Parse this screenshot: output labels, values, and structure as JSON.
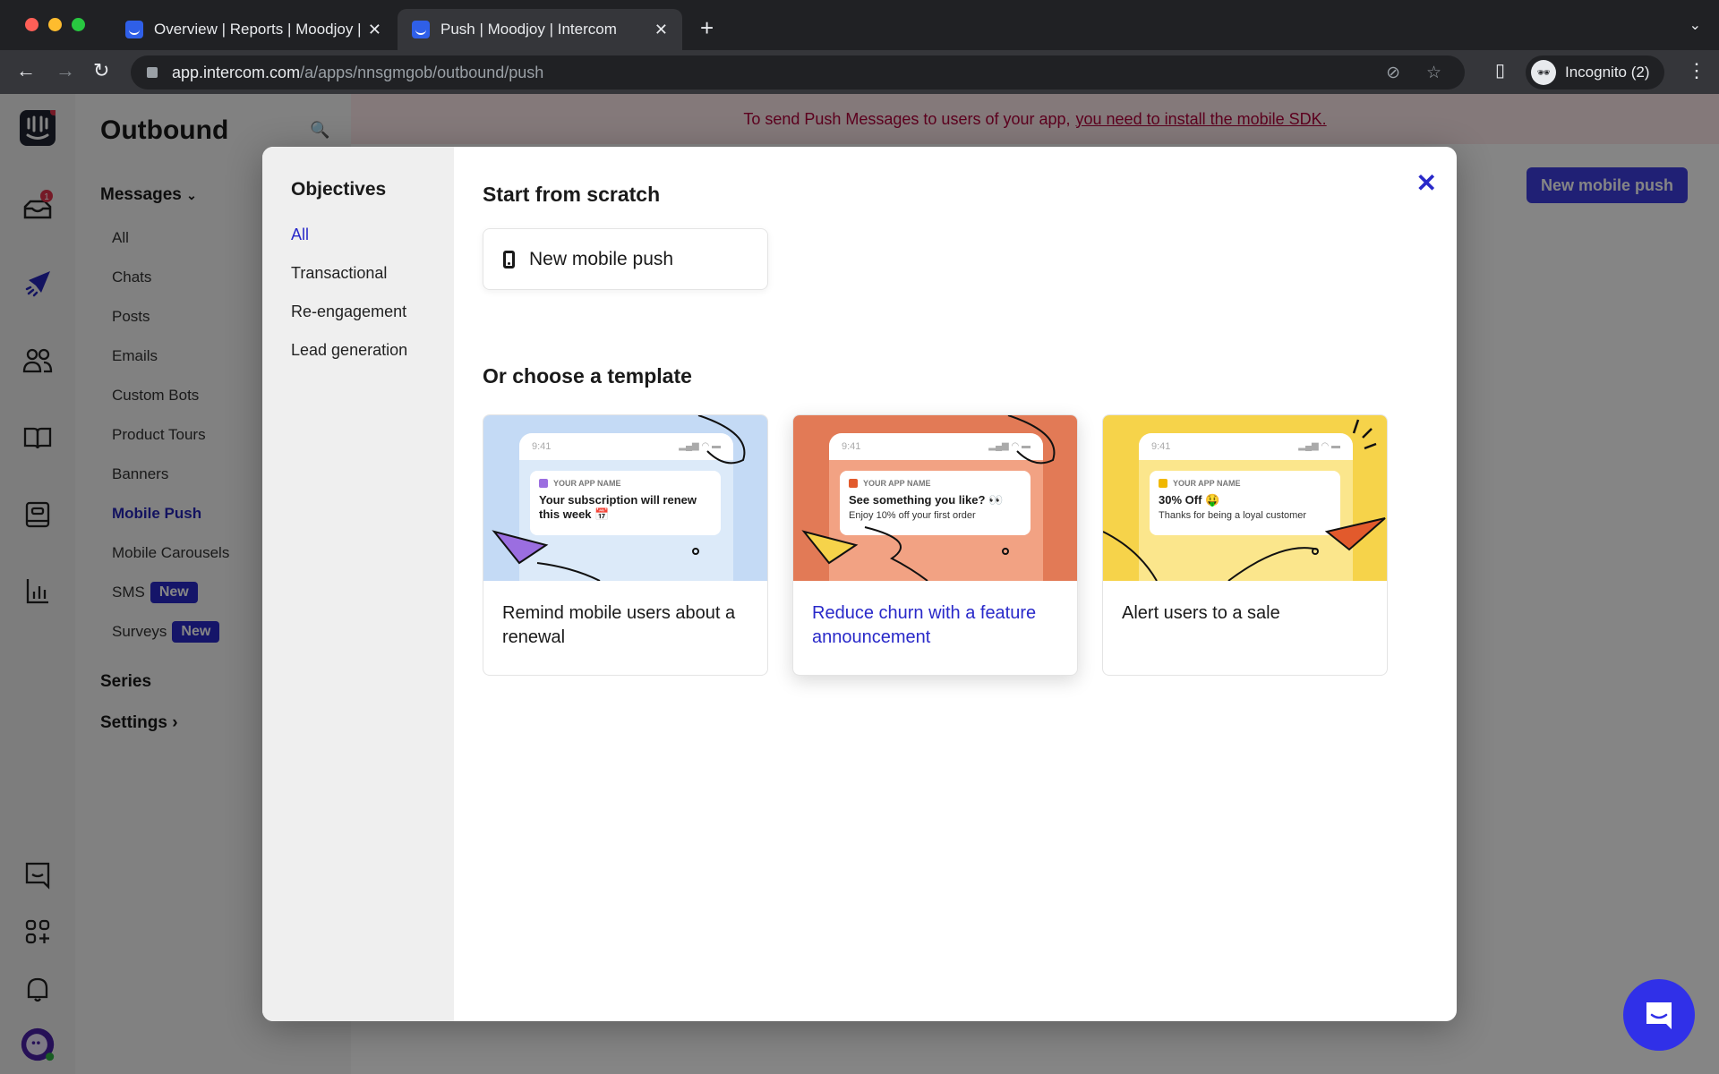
{
  "browser": {
    "tabs": [
      {
        "title": "Overview | Reports | Moodjoy |",
        "active": false
      },
      {
        "title": "Push | Moodjoy | Intercom",
        "active": true
      }
    ],
    "url_host": "app.intercom.com",
    "url_path": "/a/apps/nnsgmgob/outbound/push",
    "profile_label": "Incognito (2)"
  },
  "rail": {
    "inbox_badge": "1",
    "icons": [
      "intercom-logo-icon",
      "inbox-icon",
      "outbound-icon",
      "contacts-icon",
      "articles-icon",
      "content-icon",
      "reports-icon",
      "messenger-icon",
      "apps-icon",
      "notifications-icon",
      "avatar-icon"
    ]
  },
  "nav": {
    "title": "Outbound",
    "messages_label": "Messages",
    "items": [
      {
        "label": "All"
      },
      {
        "label": "Chats"
      },
      {
        "label": "Posts"
      },
      {
        "label": "Emails"
      },
      {
        "label": "Custom Bots"
      },
      {
        "label": "Product Tours"
      },
      {
        "label": "Banners"
      },
      {
        "label": "Mobile Push",
        "active": true
      },
      {
        "label": "Mobile Carousels"
      },
      {
        "label": "SMS",
        "badge": "New"
      },
      {
        "label": "Surveys",
        "badge": "New"
      }
    ],
    "series_label": "Series",
    "settings_label": "Settings"
  },
  "banner": {
    "text": "To send Push Messages to users of your app,",
    "link": "you need to install the mobile SDK."
  },
  "background_button": "New mobile push",
  "modal": {
    "objectives_title": "Objectives",
    "objectives": [
      {
        "label": "All",
        "active": true
      },
      {
        "label": "Transactional"
      },
      {
        "label": "Re-engagement"
      },
      {
        "label": "Lead generation"
      }
    ],
    "scratch_title": "Start from scratch",
    "scratch_button": "New mobile push",
    "template_title": "Or choose a template",
    "templates": [
      {
        "label": "Remind mobile users about a renewal",
        "bg": "#c4daf5",
        "phone_bg": "#dceaf9",
        "accent": "#9b6ee0",
        "time": "9:41",
        "app_name": "YOUR APP NAME",
        "notif_title": "Your subscription will renew this week 📅",
        "notif_sub": ""
      },
      {
        "label": "Reduce churn with a feature announcement",
        "bg": "#e27a56",
        "phone_bg": "#f2a283",
        "accent": "#e25a2c",
        "time": "9:41",
        "app_name": "YOUR APP NAME",
        "notif_title": "See something you like? 👀",
        "notif_sub": "Enjoy 10% off your first order",
        "hover": true
      },
      {
        "label": "Alert users to a sale",
        "bg": "#f6d34a",
        "phone_bg": "#fbe68c",
        "accent": "#f0b800",
        "time": "9:41",
        "app_name": "YOUR APP NAME",
        "notif_title": "30% Off 🤑",
        "notif_sub": "Thanks for being a loyal customer"
      }
    ]
  }
}
